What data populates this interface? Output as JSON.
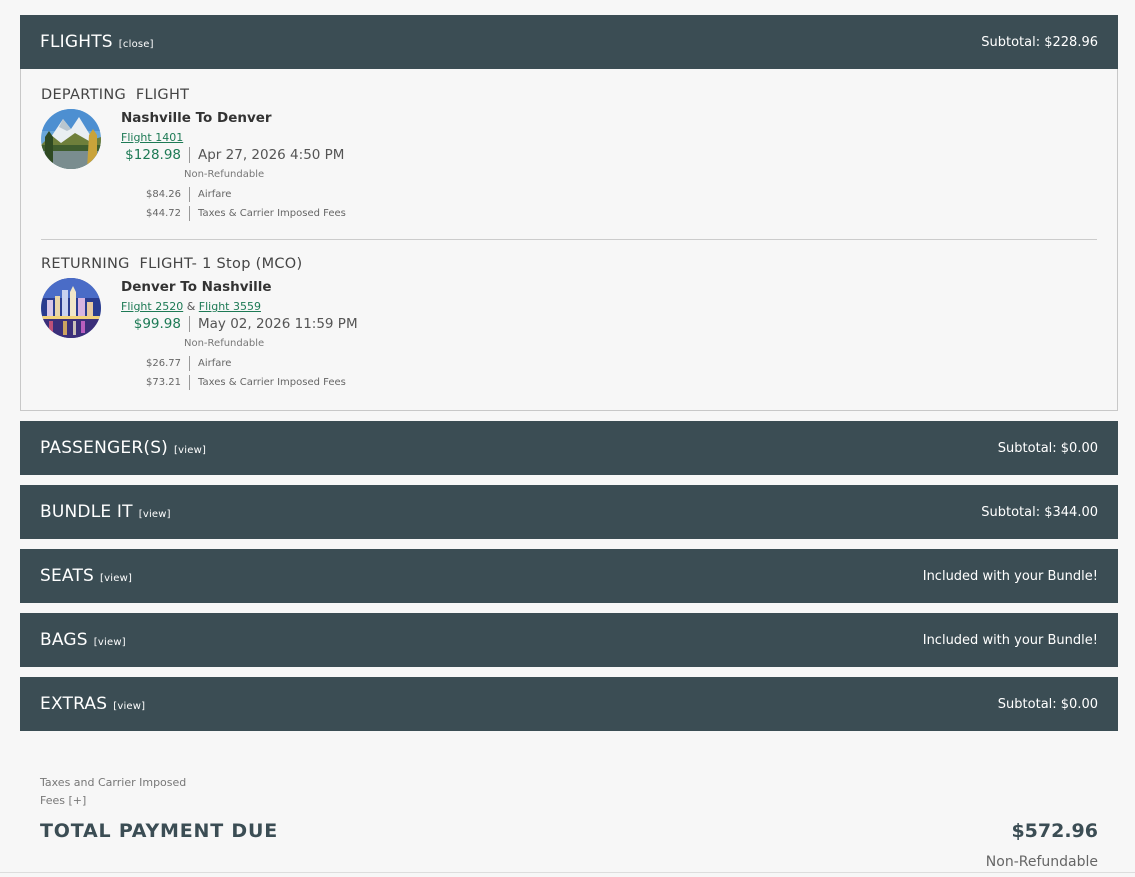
{
  "sections": {
    "flights": {
      "title": "FLIGHTS",
      "action": "[close]",
      "subtotal": "Subtotal: $228.96"
    },
    "passengers": {
      "title": "PASSENGER(S)",
      "action": "[view]",
      "subtotal": "Subtotal: $0.00"
    },
    "bundle": {
      "title": "BUNDLE IT",
      "action": "[view]",
      "subtotal": "Subtotal: $344.00"
    },
    "seats": {
      "title": "SEATS",
      "action": "[view]",
      "subtotal": "Included with your Bundle!"
    },
    "bags": {
      "title": "BAGS",
      "action": "[view]",
      "subtotal": "Included with your Bundle!"
    },
    "extras": {
      "title": "EXTRAS",
      "action": "[view]",
      "subtotal": "Subtotal: $0.00"
    }
  },
  "departing": {
    "heading": "DEPARTING  FLIGHT",
    "route": "Nashville To Denver",
    "flight1": "Flight 1401",
    "price": "$128.98",
    "datetime": "Apr 27, 2026 4:50 PM",
    "refund": "Non-Refundable",
    "airfare_amount": "$84.26",
    "airfare_label": "Airfare",
    "taxes_amount": "$44.72",
    "taxes_label": "Taxes & Carrier Imposed Fees"
  },
  "returning": {
    "heading": "RETURNING  FLIGHT- 1 Stop (MCO)",
    "route": "Denver To Nashville",
    "flight1": "Flight 2520",
    "joiner": " & ",
    "flight2": "Flight 3559",
    "price": "$99.98",
    "datetime": "May 02, 2026 11:59 PM",
    "refund": "Non-Refundable",
    "airfare_amount": "$26.77",
    "airfare_label": "Airfare",
    "taxes_amount": "$73.21",
    "taxes_label": "Taxes & Carrier Imposed Fees"
  },
  "footer": {
    "fees_note": "Taxes and Carrier Imposed Fees [+]",
    "total_label": "TOTAL PAYMENT DUE",
    "total_value": "$572.96",
    "refund": "Non-Refundable"
  },
  "colors": {
    "bar": "#3b4d54",
    "price": "#1d7a55"
  }
}
